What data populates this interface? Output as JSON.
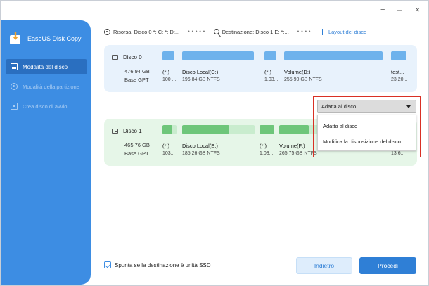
{
  "app": {
    "name": "EaseUS Disk Copy"
  },
  "sidebar": {
    "items": [
      {
        "label": "Modalità del disco",
        "active": true
      },
      {
        "label": "Modalità della partizione",
        "active": false
      },
      {
        "label": "Crea disco di avvio",
        "active": false
      }
    ]
  },
  "window_controls": {
    "menu": "≡",
    "minimize": "—",
    "close": "✕"
  },
  "pathbar": {
    "source": "Risorsa: Disco 0 *: C: *: D:...",
    "separator": "• • • • •",
    "destination": "Destinazione: Disco 1 E: *:...",
    "separator2": "• • • •",
    "layout_link": "Layout del disco"
  },
  "disks": [
    {
      "name": "Disco 0",
      "size": "476.94 GB",
      "type": "Base GPT",
      "partitions": [
        {
          "name": "(*:)",
          "info": "100 ...",
          "fill": 1.0
        },
        {
          "name": "Disco Local(C:)",
          "info": "196.84 GB NTFS",
          "fill": 1.0
        },
        {
          "name": "(*:)",
          "info": "1.03...",
          "fill": 1.0
        },
        {
          "name": "Volume(D:)",
          "info": "255.90 GB NTFS",
          "fill": 1.0
        },
        {
          "name": "test...",
          "info": "23.20...",
          "fill": 1.0
        }
      ]
    },
    {
      "name": "Disco 1",
      "size": "465.76 GB",
      "type": "Base GPT",
      "partitions": [
        {
          "name": "(*:)",
          "info": "103...",
          "fill": 0.7
        },
        {
          "name": "Disco Local(E:)",
          "info": "185.26 GB NTFS",
          "fill": 0.65
        },
        {
          "name": "(*:)",
          "info": "1.03...",
          "fill": 1.0
        },
        {
          "name": "Volume(F:)",
          "info": "265.75 GB NTFS",
          "fill": 0.6
        },
        {
          "name": "",
          "info": "13.6...",
          "fill": 1.0
        }
      ]
    }
  ],
  "dropdown": {
    "selected": "Adatta al disco",
    "options": [
      "Adatta al disco",
      "Modifica la disposizione del disco"
    ]
  },
  "ssd_checkbox": {
    "label": "Spunta se la destinazione è unità SSD",
    "checked": true
  },
  "buttons": {
    "back": "Indietro",
    "next": "Procedi"
  },
  "colors": {
    "sidebar": "#3d8de3",
    "accent": "#2f7fd6",
    "highlight": "#d93025",
    "disk0_fill": "#6eb2ec",
    "disk1_fill": "#6ec67a"
  }
}
